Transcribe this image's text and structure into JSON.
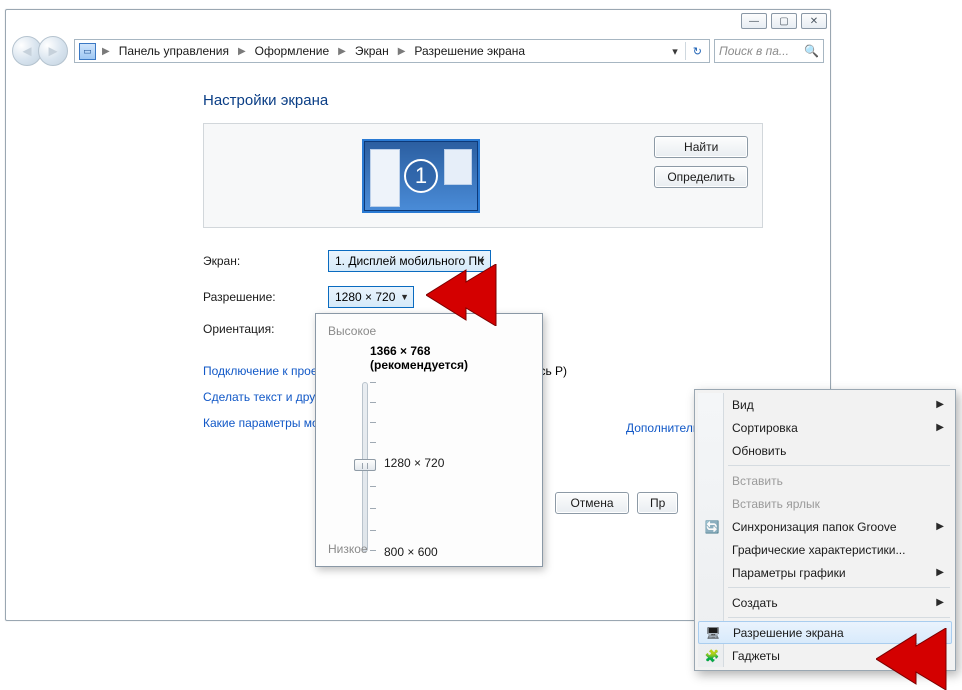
{
  "caption": {
    "minimize": "―",
    "maximize": "▢",
    "close": "✕"
  },
  "breadcrumbs": [
    "Панель управления",
    "Оформление",
    "Экран",
    "Разрешение экрана"
  ],
  "search": {
    "placeholder": "Поиск в па..."
  },
  "title": "Настройки экрана",
  "monitor_number": "1",
  "buttons": {
    "find": "Найти",
    "detect": "Определить",
    "cancel": "Отмена",
    "apply_partial": "Пр"
  },
  "form": {
    "display_label": "Экран:",
    "display_value": "1. Дисплей мобильного ПК",
    "resolution_label": "Разрешение:",
    "resolution_value": "1280 × 720",
    "orientation_label": "Ориентация:"
  },
  "links": {
    "advanced": "Дополнительные параметры",
    "projector": "Подключение к проек",
    "projector_suffix": "сь P)",
    "text_size": "Сделать текст и другие",
    "which_params": "Какие параметры мон"
  },
  "flyout": {
    "high": "Высокое",
    "low": "Низкое",
    "recommended": "1366 × 768 (рекомендуется)",
    "current": "1280 × 720",
    "min": "800 × 600"
  },
  "context_menu": {
    "items": [
      {
        "label": "Вид",
        "arrow": true
      },
      {
        "label": "Сортировка",
        "arrow": true
      },
      {
        "label": "Обновить"
      },
      {
        "sep": true
      },
      {
        "label": "Вставить",
        "disabled": true
      },
      {
        "label": "Вставить ярлык",
        "disabled": true
      },
      {
        "label": "Синхронизация папок Groove",
        "arrow": true,
        "icon": "sync-icon"
      },
      {
        "label": "Графические характеристики..."
      },
      {
        "label": "Параметры графики",
        "arrow": true
      },
      {
        "sep": true
      },
      {
        "label": "Создать",
        "arrow": true
      },
      {
        "sep": true
      },
      {
        "label": "Разрешение экрана",
        "hover": true,
        "icon": "monitor-icon"
      },
      {
        "label": "Гаджеты",
        "icon": "gadget-icon"
      }
    ]
  }
}
